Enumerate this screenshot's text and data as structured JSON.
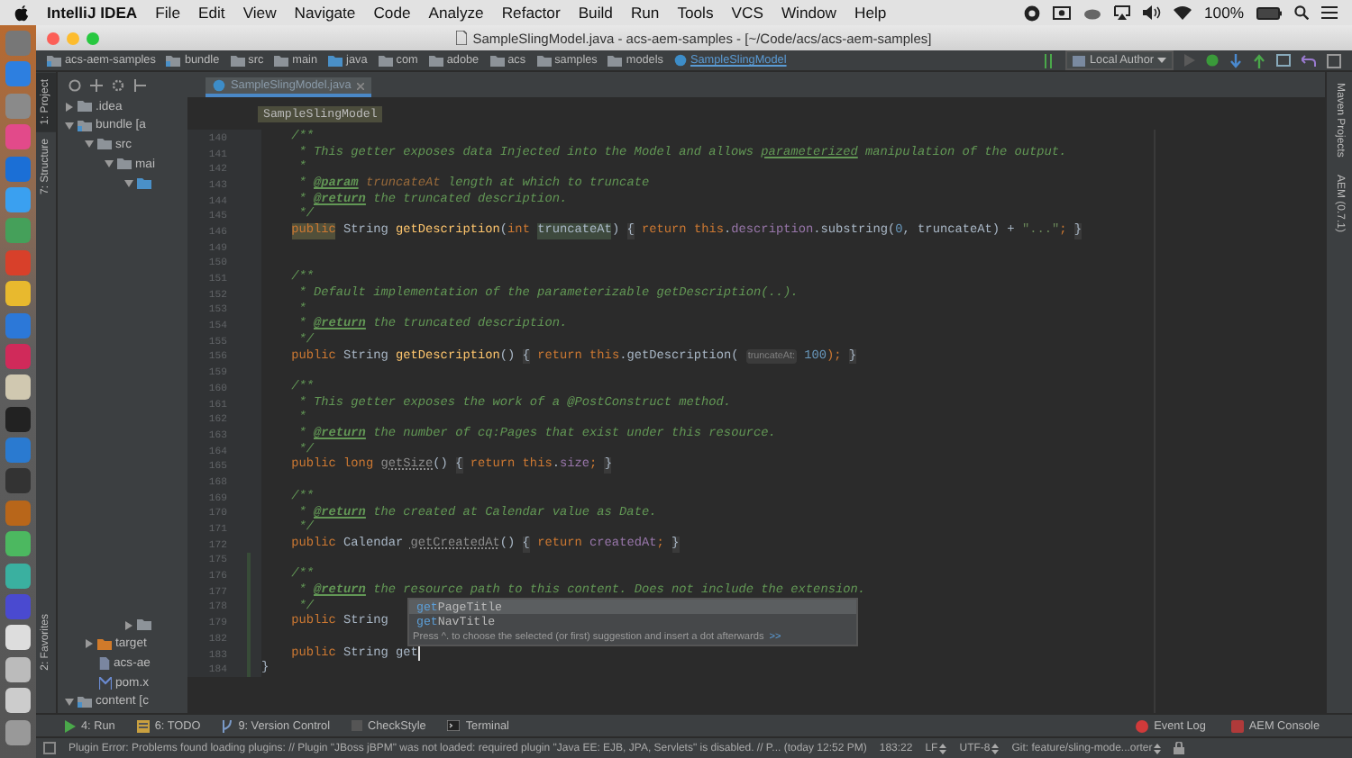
{
  "menu_bar": {
    "app_name": "IntelliJ IDEA",
    "menus": [
      "File",
      "Edit",
      "View",
      "Navigate",
      "Code",
      "Analyze",
      "Refactor",
      "Build",
      "Run",
      "Tools",
      "VCS",
      "Window",
      "Help"
    ],
    "battery": "100%"
  },
  "window": {
    "title": "SampleSlingModel.java - acs-aem-samples - [~/Code/acs/acs-aem-samples]"
  },
  "navigation_bar": {
    "breadcrumbs": [
      {
        "label": "acs-aem-samples",
        "kind": "module"
      },
      {
        "label": "bundle",
        "kind": "module"
      },
      {
        "label": "src",
        "kind": "folder"
      },
      {
        "label": "main",
        "kind": "folder"
      },
      {
        "label": "java",
        "kind": "source"
      },
      {
        "label": "com",
        "kind": "folder"
      },
      {
        "label": "adobe",
        "kind": "folder"
      },
      {
        "label": "acs",
        "kind": "folder"
      },
      {
        "label": "samples",
        "kind": "folder"
      },
      {
        "label": "models",
        "kind": "folder"
      },
      {
        "label": "SampleSlingModel",
        "kind": "class"
      }
    ],
    "run_config": "Local Author"
  },
  "left_tool_strip": [
    {
      "label": "1: Project",
      "selected": true
    },
    {
      "label": "7: Structure",
      "selected": false
    },
    {
      "label": "2: Favorites",
      "selected": false
    }
  ],
  "project_tree": [
    {
      "label": ".idea",
      "kind": "folder",
      "expanded": false
    },
    {
      "label": "bundle [a",
      "kind": "module",
      "expanded": true,
      "children": [
        {
          "label": "src",
          "kind": "folder",
          "expanded": true,
          "children": [
            {
              "label": "mai",
              "kind": "folder",
              "expanded": true,
              "children": [
                {
                  "kind": "source",
                  "expanded": true
                },
                {
                  "kind": "folder",
                  "expanded": false
                }
              ]
            }
          ]
        },
        {
          "label": "target",
          "kind": "excluded",
          "expanded": false
        },
        {
          "label": "acs-ae",
          "kind": "file"
        },
        {
          "label": "pom.x",
          "kind": "pom"
        }
      ]
    },
    {
      "label": "content [c",
      "kind": "module",
      "expanded": true
    }
  ],
  "editor": {
    "tabs": [
      {
        "label": "SampleSlingModel.java",
        "selected": true
      }
    ],
    "breadcrumb": "SampleSlingModel",
    "body_lines": [
      {
        "number": "140",
        "changed": false,
        "tokens": [
          {
            "kind": "c",
            "text": "/**"
          }
        ]
      },
      {
        "number": "141",
        "changed": false,
        "tokens": [
          {
            "kind": "c",
            "text": " * This getter exposes data Injected into the Model and allows "
          },
          {
            "kind": "marked",
            "text": "parameterized"
          },
          {
            "kind": "c",
            "text": " manipulation of the output."
          }
        ]
      },
      {
        "number": "142",
        "changed": false,
        "tokens": [
          {
            "kind": "c",
            "text": " *"
          }
        ]
      },
      {
        "number": "143",
        "changed": false,
        "tokens": [
          {
            "kind": "c",
            "text": " * "
          },
          {
            "kind": "tag",
            "text": "@param"
          },
          {
            "kind": "dparam",
            "text": " truncateAt"
          },
          {
            "kind": "c",
            "text": " length at which to truncate"
          }
        ]
      },
      {
        "number": "144",
        "changed": false,
        "tokens": [
          {
            "kind": "c",
            "text": " * "
          },
          {
            "kind": "tag",
            "text": "@return"
          },
          {
            "kind": "c",
            "text": " the truncated description."
          }
        ]
      },
      {
        "number": "145",
        "changed": false,
        "tokens": [
          {
            "kind": "c",
            "text": " */"
          }
        ]
      },
      {
        "number": "146",
        "changed": false,
        "tokens": [
          {
            "kind": "kwhl",
            "text": "public"
          },
          {
            "kind": "plain",
            "text": " String "
          },
          {
            "kind": "method",
            "text": "getDescription"
          },
          {
            "kind": "plain",
            "text": "("
          },
          {
            "kind": "kw",
            "text": "int "
          },
          {
            "kind": "paramhl",
            "text": "truncateAt"
          },
          {
            "kind": "plain",
            "text": ") "
          },
          {
            "kind": "fold",
            "text": "{"
          },
          {
            "kind": "kw",
            "text": " return this"
          },
          {
            "kind": "plain",
            "text": "."
          },
          {
            "kind": "field",
            "text": "description"
          },
          {
            "kind": "plain",
            "text": ".substring("
          },
          {
            "kind": "num",
            "text": "0"
          },
          {
            "kind": "plain",
            "text": ", truncateAt) + "
          },
          {
            "kind": "str",
            "text": "\"...\""
          },
          {
            "kind": "kw",
            "text": "; "
          },
          {
            "kind": "fold",
            "text": "}"
          }
        ]
      },
      {
        "number": "149",
        "changed": false
      },
      {
        "number": "150",
        "changed": false
      },
      {
        "number": "151",
        "changed": false,
        "tokens": [
          {
            "kind": "c",
            "text": "/**"
          }
        ]
      },
      {
        "number": "152",
        "changed": false,
        "tokens": [
          {
            "kind": "c",
            "text": " * Default implementation of the parameterizable getDescription(..)."
          }
        ]
      },
      {
        "number": "153",
        "changed": false,
        "tokens": [
          {
            "kind": "c",
            "text": " *"
          }
        ]
      },
      {
        "number": "154",
        "changed": false,
        "tokens": [
          {
            "kind": "c",
            "text": " * "
          },
          {
            "kind": "tag",
            "text": "@return"
          },
          {
            "kind": "c",
            "text": " the truncated description."
          }
        ]
      },
      {
        "number": "155",
        "changed": false,
        "tokens": [
          {
            "kind": "c",
            "text": " */"
          }
        ]
      },
      {
        "number": "156",
        "changed": false,
        "tokens": [
          {
            "kind": "kw",
            "text": "public"
          },
          {
            "kind": "plain",
            "text": " String "
          },
          {
            "kind": "method",
            "text": "getDescription"
          },
          {
            "kind": "plain",
            "text": "() "
          },
          {
            "kind": "fold",
            "text": "{"
          },
          {
            "kind": "kw",
            "text": " return this"
          },
          {
            "kind": "plain",
            "text": ".getDescription( "
          },
          {
            "kind": "hint",
            "text": "truncateAt:"
          },
          {
            "kind": "num",
            "text": " 100"
          },
          {
            "kind": "kw",
            "text": "); "
          },
          {
            "kind": "fold",
            "text": "}"
          }
        ]
      },
      {
        "number": "159",
        "changed": false
      },
      {
        "number": "160",
        "changed": false,
        "tokens": [
          {
            "kind": "c",
            "text": "/**"
          }
        ]
      },
      {
        "number": "161",
        "changed": false,
        "tokens": [
          {
            "kind": "c",
            "text": " * This getter exposes the work of a @PostConstruct method."
          }
        ]
      },
      {
        "number": "162",
        "changed": false,
        "tokens": [
          {
            "kind": "c",
            "text": " *"
          }
        ]
      },
      {
        "number": "163",
        "changed": false,
        "tokens": [
          {
            "kind": "c",
            "text": " * "
          },
          {
            "kind": "tag",
            "text": "@return"
          },
          {
            "kind": "c",
            "text": " the number of cq:Pages that exist under this resource."
          }
        ]
      },
      {
        "number": "164",
        "changed": false,
        "tokens": [
          {
            "kind": "c",
            "text": " */"
          }
        ]
      },
      {
        "number": "165",
        "changed": false,
        "tokens": [
          {
            "kind": "kw",
            "text": "public long "
          },
          {
            "kind": "unused",
            "text": "getSize"
          },
          {
            "kind": "plain",
            "text": "() "
          },
          {
            "kind": "fold",
            "text": "{"
          },
          {
            "kind": "kw",
            "text": " return this"
          },
          {
            "kind": "plain",
            "text": "."
          },
          {
            "kind": "field",
            "text": "size"
          },
          {
            "kind": "kw",
            "text": "; "
          },
          {
            "kind": "fold",
            "text": "}"
          }
        ]
      },
      {
        "number": "168",
        "changed": false
      },
      {
        "number": "169",
        "changed": false,
        "tokens": [
          {
            "kind": "c",
            "text": "/**"
          }
        ]
      },
      {
        "number": "170",
        "changed": false,
        "tokens": [
          {
            "kind": "c",
            "text": " * "
          },
          {
            "kind": "tag",
            "text": "@return"
          },
          {
            "kind": "c",
            "text": " the created at Calendar value as Date."
          }
        ]
      },
      {
        "number": "171",
        "changed": false,
        "tokens": [
          {
            "kind": "c",
            "text": " */"
          }
        ]
      },
      {
        "number": "172",
        "changed": false,
        "tokens": [
          {
            "kind": "kw",
            "text": "public"
          },
          {
            "kind": "plain",
            "text": " Calendar "
          },
          {
            "kind": "unused",
            "text": "getCreatedAt"
          },
          {
            "kind": "plain",
            "text": "() "
          },
          {
            "kind": "fold",
            "text": "{"
          },
          {
            "kind": "kw",
            "text": " return "
          },
          {
            "kind": "field",
            "text": "createdAt"
          },
          {
            "kind": "kw",
            "text": "; "
          },
          {
            "kind": "fold",
            "text": "}"
          }
        ]
      },
      {
        "number": "175",
        "changed": true
      },
      {
        "number": "176",
        "changed": true,
        "tokens": [
          {
            "kind": "c",
            "text": "/**"
          }
        ]
      },
      {
        "number": "177",
        "changed": true,
        "tokens": [
          {
            "kind": "c",
            "text": " * "
          },
          {
            "kind": "tag",
            "text": "@return"
          },
          {
            "kind": "c",
            "text": " the resource path to this content. Does not include the extension."
          }
        ]
      },
      {
        "number": "178",
        "changed": true,
        "tokens": [
          {
            "kind": "c",
            "text": " */"
          }
        ]
      },
      {
        "number": "179",
        "changed": true,
        "tokens": [
          {
            "kind": "kw",
            "text": "public"
          },
          {
            "kind": "plain",
            "text": " String"
          }
        ]
      },
      {
        "number": "182",
        "changed": true
      },
      {
        "number": "183",
        "changed": true,
        "caret": true,
        "tokens": [
          {
            "kind": "kw",
            "text": "public"
          },
          {
            "kind": "plain",
            "text": " String get"
          }
        ]
      }
    ],
    "end_lines": [
      {
        "number": "184",
        "changed": true,
        "text": "}"
      }
    ],
    "completion": {
      "items": [
        {
          "match": "get",
          "rest": "PageTitle",
          "selected": true
        },
        {
          "match": "get",
          "rest": "NavTitle",
          "selected": false
        }
      ],
      "hint": "Press ^. to choose the selected (or first) suggestion and insert a dot afterwards",
      "hint_link": ">>"
    }
  },
  "right_tool_strip": [
    {
      "label": "Maven Projects"
    },
    {
      "label": "AEM (0.7.1)"
    }
  ],
  "tool_windows": [
    {
      "label": "4: Run",
      "kind": "run"
    },
    {
      "label": "6: TODO",
      "kind": "todo"
    },
    {
      "label": "9: Version Control",
      "kind": "vcs"
    },
    {
      "label": "CheckStyle",
      "kind": "checkstyle"
    },
    {
      "label": "Terminal",
      "kind": "terminal"
    }
  ],
  "tool_windows_right": [
    {
      "label": "Event Log",
      "kind": "log"
    },
    {
      "label": "AEM Console",
      "kind": "aem"
    }
  ],
  "status_bar": {
    "message": "Plugin Error: Problems found loading plugins: // Plugin \"JBoss jBPM\" was not loaded: required plugin \"Java EE: EJB, JPA, Servlets\" is disabled. // P... (today 12:52 PM)",
    "position": "183:22",
    "line_separator": "LF",
    "encoding": "UTF-8",
    "vcs_branch": "Git: feature/sling-mode...orter"
  }
}
